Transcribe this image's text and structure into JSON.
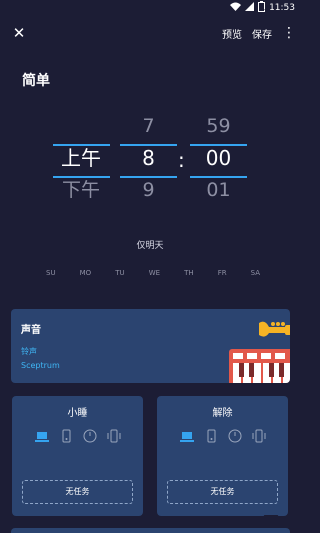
{
  "status_bar": {
    "time": "11:53",
    "battery": "1"
  },
  "toolbar": {
    "preview_label": "预览",
    "save_label": "保存"
  },
  "section_title": "简单",
  "picker": {
    "ampm": {
      "prev": "",
      "selected": "上午",
      "next": "下午"
    },
    "hour": {
      "prev": "7",
      "selected": "8",
      "next": "9"
    },
    "separator": ":",
    "minute": {
      "prev": "59",
      "selected": "00",
      "next": "01"
    }
  },
  "repeat_label": "仅明天",
  "weekdays": [
    "SU",
    "MO",
    "TU",
    "WE",
    "TH",
    "FR",
    "SA"
  ],
  "sound": {
    "title": "声音",
    "ringtone_label": "铃声",
    "ringtone_value": "Sceptrum"
  },
  "snooze_card": {
    "title": "小睡",
    "task_label": "无任务"
  },
  "dismiss_card": {
    "title": "解除",
    "task_label": "无任务"
  },
  "colors": {
    "accent": "#35a4f0",
    "card": "#2b4470",
    "background": "#1c1d35"
  }
}
